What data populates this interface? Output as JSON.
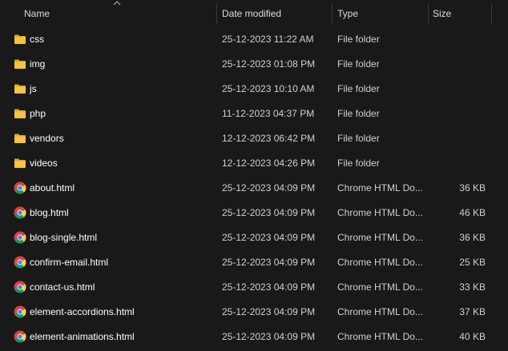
{
  "columns": {
    "name": "Name",
    "date": "Date modified",
    "type": "Type",
    "size": "Size"
  },
  "colors": {
    "background": "#191919",
    "folder": "#f6c443",
    "folder_dark": "#e0a82a",
    "text": "#ffffff",
    "secondary_text": "#d0d0d0"
  },
  "rows": [
    {
      "name": "css",
      "date": "25-12-2023 11:22 AM",
      "type": "File folder",
      "size": "",
      "icon": "folder-icon"
    },
    {
      "name": "img",
      "date": "25-12-2023 01:08 PM",
      "type": "File folder",
      "size": "",
      "icon": "folder-icon"
    },
    {
      "name": "js",
      "date": "25-12-2023 10:10 AM",
      "type": "File folder",
      "size": "",
      "icon": "folder-icon"
    },
    {
      "name": "php",
      "date": "11-12-2023 04:37 PM",
      "type": "File folder",
      "size": "",
      "icon": "folder-icon"
    },
    {
      "name": "vendors",
      "date": "12-12-2023 06:42 PM",
      "type": "File folder",
      "size": "",
      "icon": "folder-icon"
    },
    {
      "name": "videos",
      "date": "12-12-2023 04:26 PM",
      "type": "File folder",
      "size": "",
      "icon": "folder-icon"
    },
    {
      "name": "about.html",
      "date": "25-12-2023 04:09 PM",
      "type": "Chrome HTML Do...",
      "size": "36 KB",
      "icon": "chrome-icon"
    },
    {
      "name": "blog.html",
      "date": "25-12-2023 04:09 PM",
      "type": "Chrome HTML Do...",
      "size": "46 KB",
      "icon": "chrome-icon"
    },
    {
      "name": "blog-single.html",
      "date": "25-12-2023 04:09 PM",
      "type": "Chrome HTML Do...",
      "size": "36 KB",
      "icon": "chrome-icon"
    },
    {
      "name": "confirm-email.html",
      "date": "25-12-2023 04:09 PM",
      "type": "Chrome HTML Do...",
      "size": "25 KB",
      "icon": "chrome-icon"
    },
    {
      "name": "contact-us.html",
      "date": "25-12-2023 04:09 PM",
      "type": "Chrome HTML Do...",
      "size": "33 KB",
      "icon": "chrome-icon"
    },
    {
      "name": "element-accordions.html",
      "date": "25-12-2023 04:09 PM",
      "type": "Chrome HTML Do...",
      "size": "37 KB",
      "icon": "chrome-icon"
    },
    {
      "name": "element-animations.html",
      "date": "25-12-2023 04:09 PM",
      "type": "Chrome HTML Do...",
      "size": "40 KB",
      "icon": "chrome-icon"
    }
  ]
}
